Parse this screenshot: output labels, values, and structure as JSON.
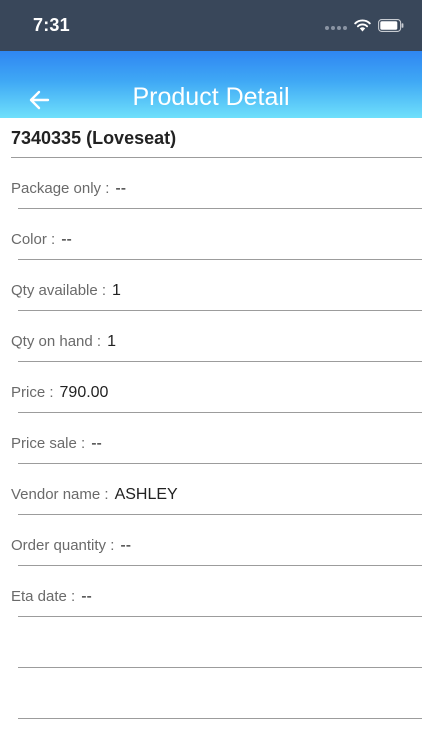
{
  "status_bar": {
    "time": "7:31",
    "icons": [
      "cellular-signal-icon",
      "wifi-icon",
      "battery-icon"
    ]
  },
  "nav": {
    "title": "Product Detail",
    "back_icon": "arrow-left-icon",
    "gradient_top": "#2f86f2",
    "gradient_bottom": "#6fe0fb"
  },
  "product": {
    "title": "7340335 (Loveseat)"
  },
  "details": [
    {
      "label": "Package only :",
      "value": "--"
    },
    {
      "label": "Color :",
      "value": "--"
    },
    {
      "label": "Qty available :",
      "value": "1"
    },
    {
      "label": "Qty on hand :",
      "value": "1"
    },
    {
      "label": "Price :",
      "value": "790.00"
    },
    {
      "label": "Price sale :",
      "value": "--"
    },
    {
      "label": "Vendor name :",
      "value": "ASHLEY"
    },
    {
      "label": "Order quantity :",
      "value": "--"
    },
    {
      "label": "Eta date :",
      "value": "--"
    },
    {
      "label": "",
      "value": ""
    },
    {
      "label": "",
      "value": ""
    }
  ]
}
